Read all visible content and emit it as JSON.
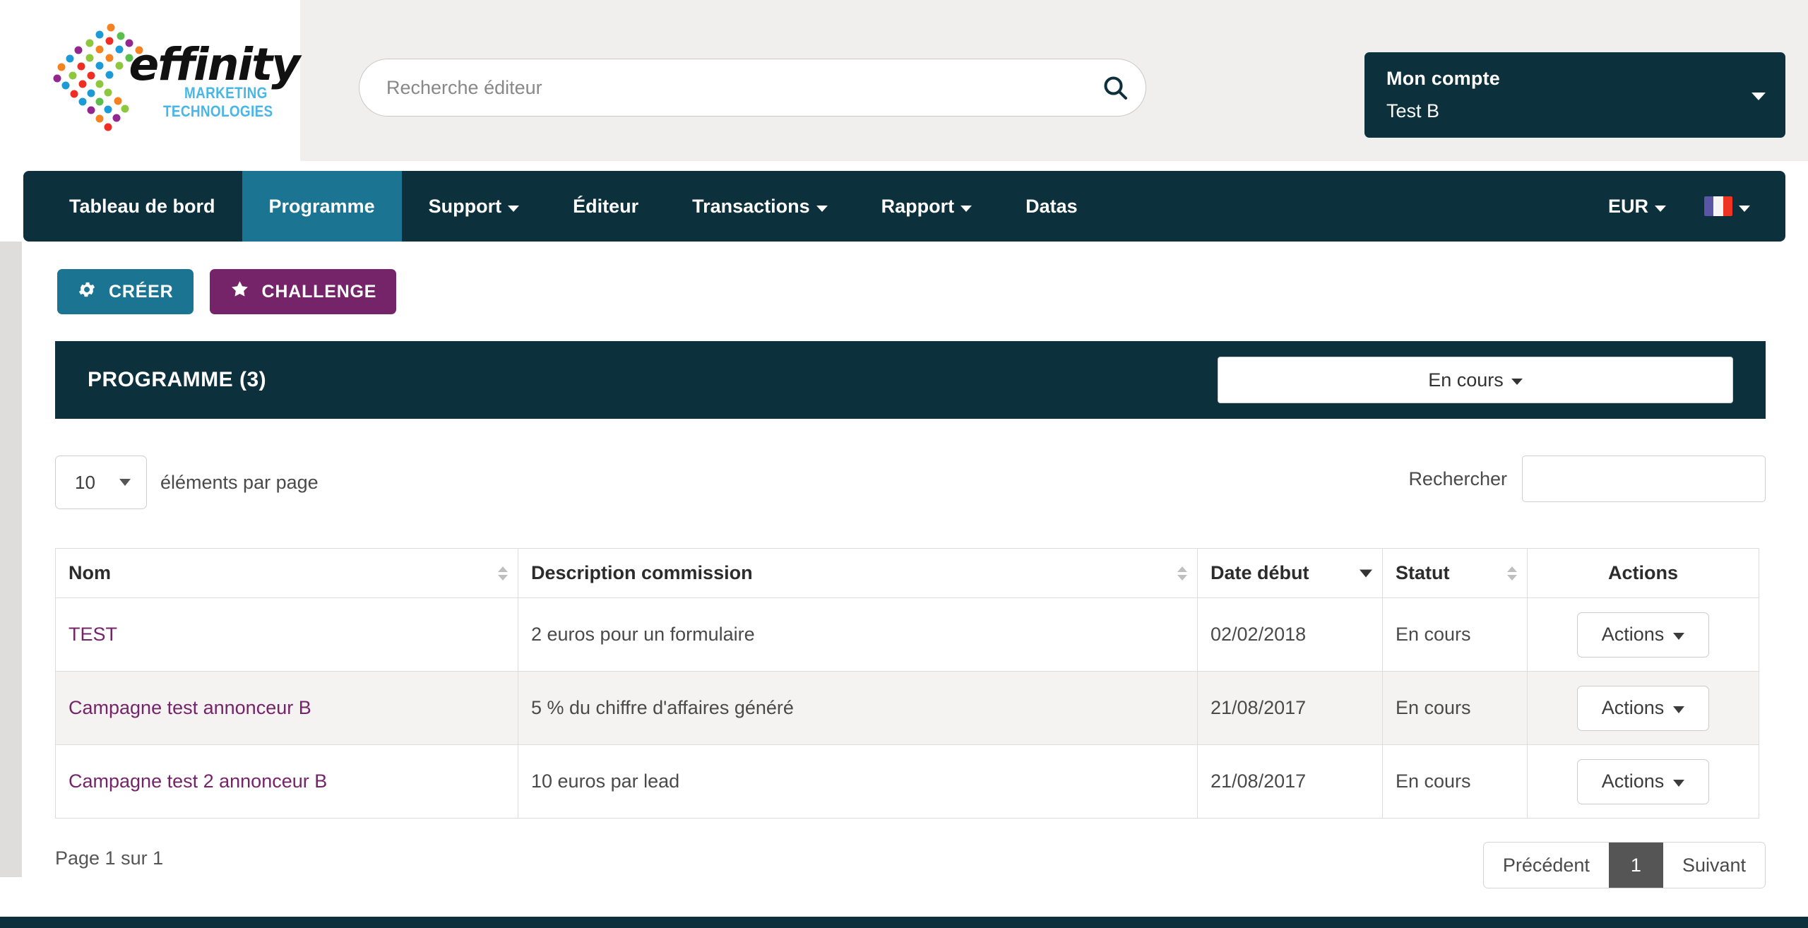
{
  "brand": {
    "name": "effinity",
    "tagline_line1": "MARKETING",
    "tagline_line2": "TECHNOLOGIES",
    "accent_teal": "#1b7492",
    "dark_teal": "#0c303c",
    "purple": "#76246a",
    "tagline_color": "#49b6e8"
  },
  "header": {
    "search_placeholder": "Recherche éditeur",
    "search_value": "",
    "search_icon": "search-icon",
    "account_label": "Mon compte",
    "account_name": "Test B"
  },
  "nav": {
    "items": [
      {
        "label": "Tableau de bord",
        "caret": false,
        "active": false
      },
      {
        "label": "Programme",
        "caret": false,
        "active": true
      },
      {
        "label": "Support",
        "caret": true,
        "active": false
      },
      {
        "label": "Éditeur",
        "caret": false,
        "active": false
      },
      {
        "label": "Transactions",
        "caret": true,
        "active": false
      },
      {
        "label": "Rapport",
        "caret": true,
        "active": false
      },
      {
        "label": "Datas",
        "caret": false,
        "active": false
      }
    ],
    "currency": "EUR",
    "language_flag": "france-flag-icon"
  },
  "toolbar": {
    "create_label": "CRÉER",
    "create_icon": "gear-icon",
    "challenge_label": "CHALLENGE",
    "challenge_icon": "star-icon"
  },
  "panel": {
    "title": "PROGRAMME (3)",
    "status_filter": "En cours"
  },
  "controls": {
    "per_page_value": "10",
    "per_page_label": "éléments par page",
    "search_label": "Rechercher",
    "search_value": ""
  },
  "table": {
    "columns": [
      {
        "label": "Nom",
        "sort": "both"
      },
      {
        "label": "Description commission",
        "sort": "both"
      },
      {
        "label": "Date début",
        "sort": "desc"
      },
      {
        "label": "Statut",
        "sort": "both"
      },
      {
        "label": "Actions",
        "sort": "none"
      }
    ],
    "rows": [
      {
        "name": "TEST",
        "description": "2 euros pour un formulaire",
        "date": "02/02/2018",
        "status": "En cours",
        "action_label": "Actions"
      },
      {
        "name": "Campagne test annonceur B",
        "description": "5 % du chiffre d'affaires généré",
        "date": "21/08/2017",
        "status": "En cours",
        "action_label": "Actions"
      },
      {
        "name": "Campagne test 2 annonceur B",
        "description": "10 euros par lead",
        "date": "21/08/2017",
        "status": "En cours",
        "action_label": "Actions"
      }
    ]
  },
  "pagination": {
    "page_info": "Page 1 sur 1",
    "prev_label": "Précédent",
    "current_page": "1",
    "next_label": "Suivant"
  }
}
